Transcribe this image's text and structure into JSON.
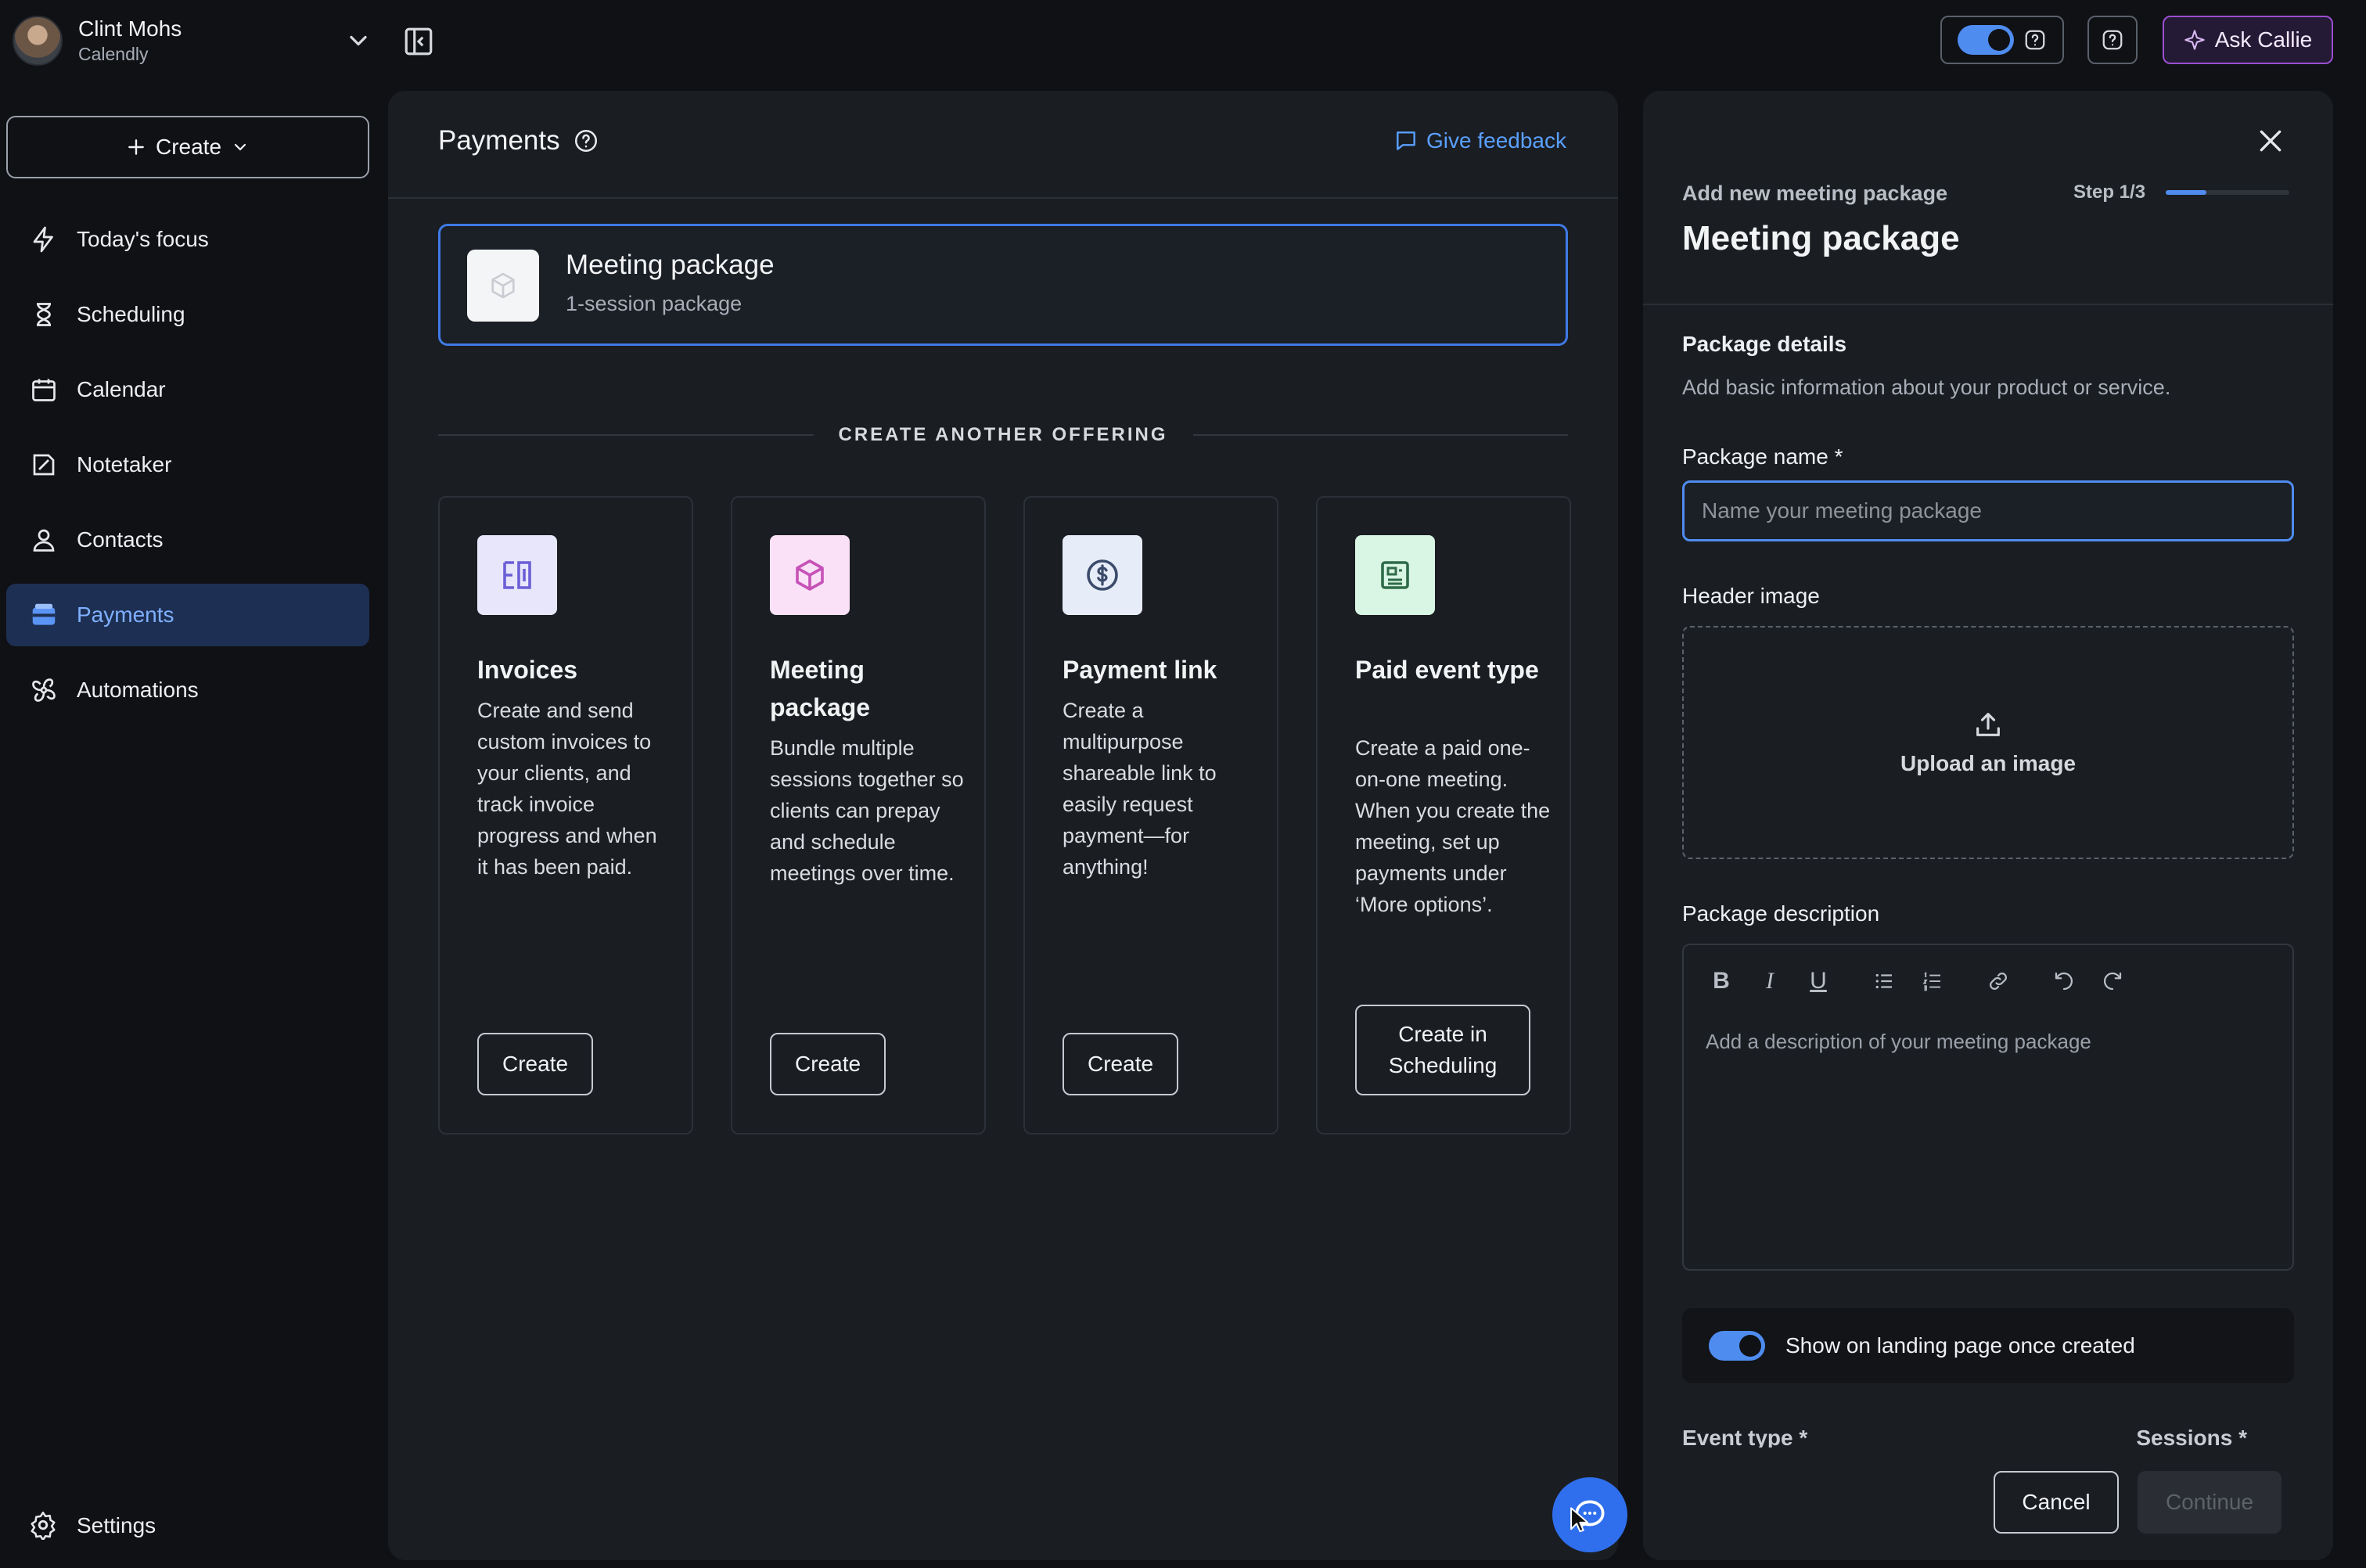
{
  "user": {
    "name": "Clint Mohs",
    "org": "Calendly"
  },
  "sidebar": {
    "create_label": "Create",
    "items": [
      {
        "label": "Today's focus",
        "icon": "lightning-icon"
      },
      {
        "label": "Scheduling",
        "icon": "hourglass-icon"
      },
      {
        "label": "Calendar",
        "icon": "calendar-icon"
      },
      {
        "label": "Notetaker",
        "icon": "notetaker-icon"
      },
      {
        "label": "Contacts",
        "icon": "contacts-icon"
      },
      {
        "label": "Payments",
        "icon": "wallet-icon",
        "active": true
      },
      {
        "label": "Automations",
        "icon": "automations-icon"
      }
    ],
    "settings_label": "Settings"
  },
  "topbar": {
    "ask_callie": "Ask Callie"
  },
  "main": {
    "title": "Payments",
    "feedback": "Give feedback",
    "selected": {
      "title": "Meeting package",
      "subtitle": "1-session package"
    },
    "divider": "CREATE ANOTHER OFFERING",
    "offerings": [
      {
        "title": "Invoices",
        "desc": "Create and send custom invoices to your clients, and track invoice progress and when it has been paid.",
        "button": "Create",
        "icon": "invoice-icon",
        "bg": "#e8e6fb",
        "fg": "#6b5fd6"
      },
      {
        "title": "Meeting package",
        "desc": "Bundle multiple sessions together so clients can prepay and schedule meetings over time.",
        "button": "Create",
        "icon": "package-icon",
        "bg": "#fbe1f7",
        "fg": "#c652b8"
      },
      {
        "title": "Payment link",
        "desc": "Create a multipurpose shareable link to easily request payment—for anything!",
        "button": "Create",
        "icon": "dollar-icon",
        "bg": "#e7edf8",
        "fg": "#3b4b6b"
      },
      {
        "title": "Paid event type",
        "desc": "Create a paid one-on-one meeting. When you create the meeting, set up payments under ‘More options’.",
        "button": "Create in Scheduling",
        "icon": "event-icon",
        "bg": "#d9f5e4",
        "fg": "#2e6b49"
      }
    ]
  },
  "drawer": {
    "kicker": "Add new meeting package",
    "step": "Step 1/3",
    "step_progress": 0.33,
    "title": "Meeting package",
    "section_title": "Package details",
    "section_sub": "Add basic information about your product or service.",
    "name_label": "Package name *",
    "name_placeholder": "Name your meeting package",
    "header_image_label": "Header image",
    "upload_label": "Upload an image",
    "description_label": "Package description",
    "description_placeholder": "Add a description of your meeting package",
    "landing_toggle_label": "Show on landing page once created",
    "event_type_label": "Event type *",
    "sessions_label": "Sessions *",
    "cancel": "Cancel",
    "continue": "Continue"
  }
}
